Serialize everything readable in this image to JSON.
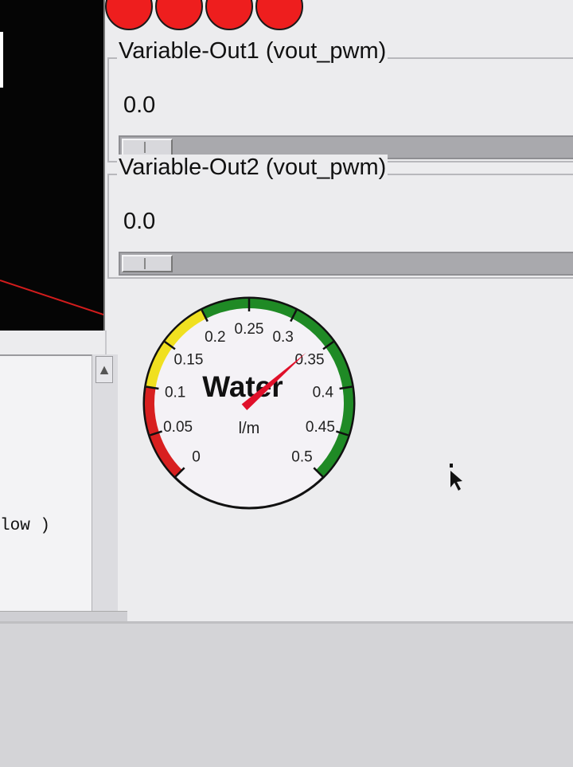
{
  "leds": {
    "count": 4,
    "color": "#ee1e1e"
  },
  "groups": [
    {
      "label": "Variable-Out1 (vout_pwm)",
      "value": "0.0",
      "slider_fraction": 0.0
    },
    {
      "label": "Variable-Out2 (vout_pwm)",
      "value": "0.0",
      "slider_fraction": 0.0
    }
  ],
  "panel": {
    "text": "low )"
  },
  "gauge": {
    "title": "Water",
    "unit": "l/m",
    "ticks": [
      "0",
      "0.05",
      "0.1",
      "0.15",
      "0.2",
      "0.25",
      "0.3",
      "0.35",
      "0.4",
      "0.45",
      "0.5"
    ],
    "min": 0,
    "max": 0.5,
    "value": 0.34,
    "zones": [
      {
        "from": 0,
        "to": 0.1,
        "color": "#d82020"
      },
      {
        "from": 0.1,
        "to": 0.2,
        "color": "#f0e020"
      },
      {
        "from": 0.2,
        "to": 0.5,
        "color": "#1f8a25"
      }
    ],
    "needle_color": "#e0102a"
  }
}
